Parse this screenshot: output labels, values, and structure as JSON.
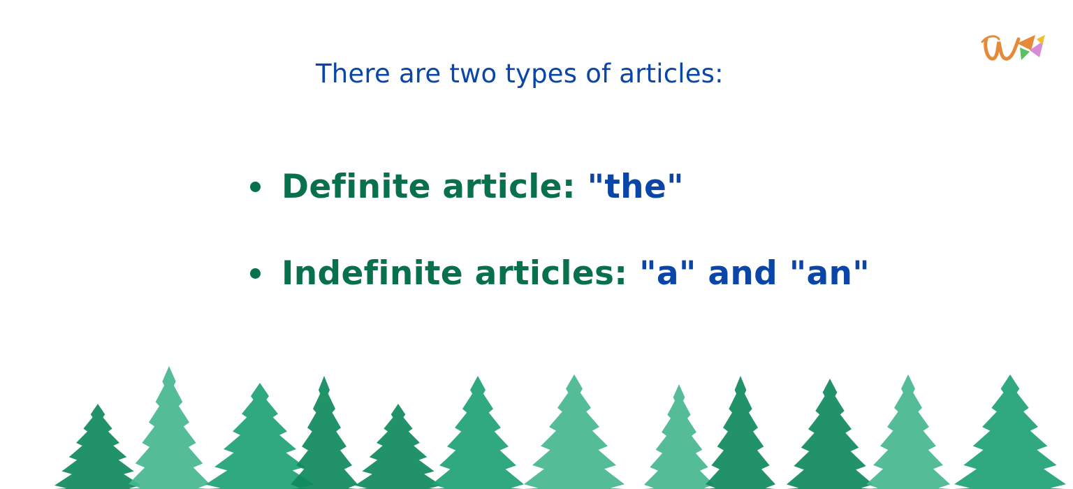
{
  "heading": "There are two types of articles:",
  "bullets": [
    {
      "label": "Definite article:",
      "example": "\"the\""
    },
    {
      "label": "Indefinite articles:",
      "example": "\"a\" and \"an\""
    }
  ],
  "logo": {
    "icon": "w-pennant-logo-icon"
  },
  "decoration": {
    "icon": "watercolor-pine-trees"
  },
  "colors": {
    "heading": "#0a45a8",
    "label": "#08704a",
    "example": "#0a45a8",
    "tree_dark": "#0f8a5c",
    "tree_mid": "#1ea276",
    "tree_light": "#45b78f",
    "logo_orange": "#e68a3a",
    "logo_green": "#5cbf62",
    "logo_pink": "#d98ad8",
    "logo_yellow": "#f0c02d"
  }
}
